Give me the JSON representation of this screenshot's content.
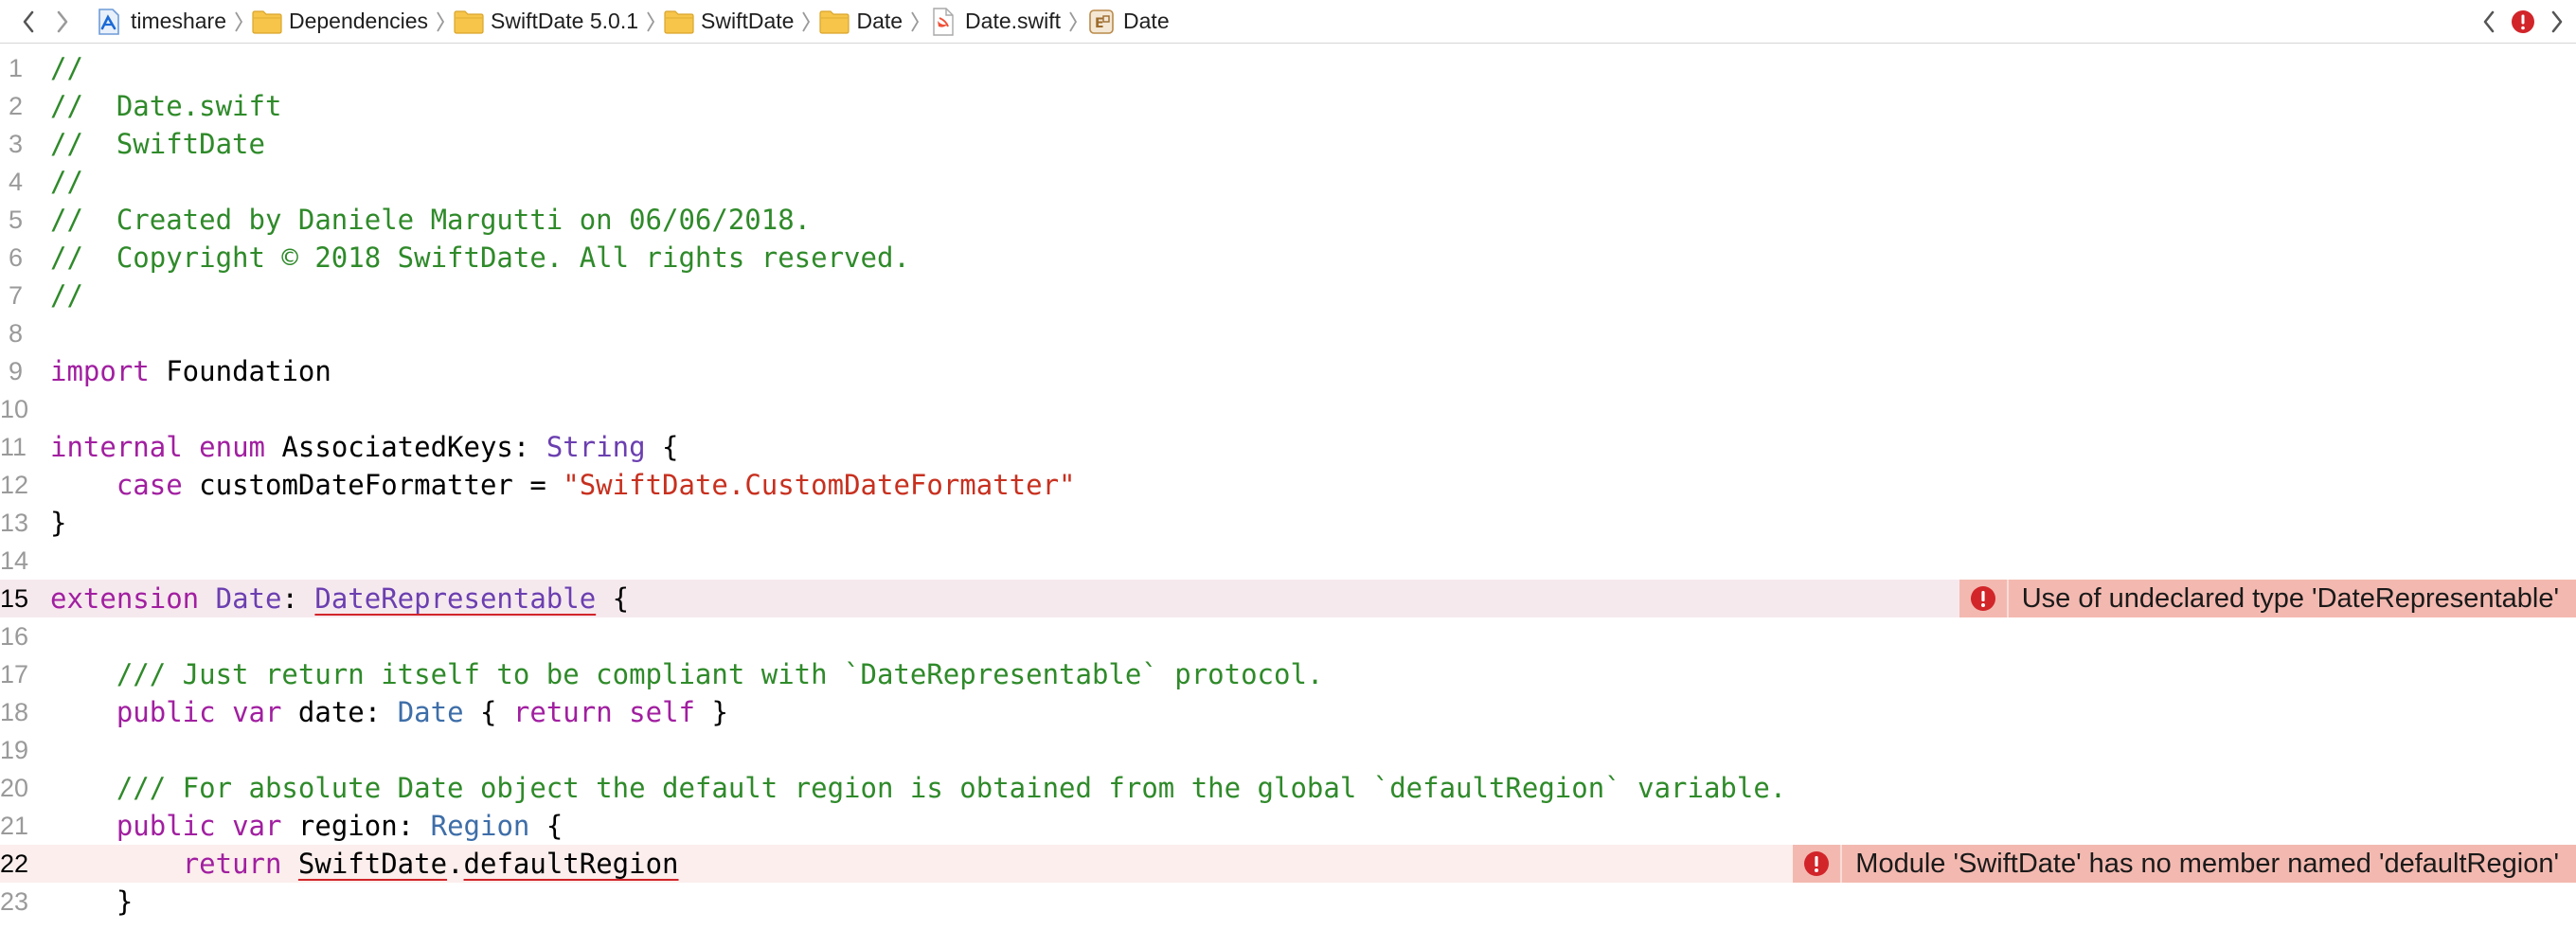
{
  "jumpbar": {
    "back_icon": "chevron-left-icon",
    "forward_icon": "chevron-right-icon",
    "crumbs": [
      {
        "label": "timeshare",
        "icon": "xcode-project-icon"
      },
      {
        "label": "Dependencies",
        "icon": "folder-icon"
      },
      {
        "label": "SwiftDate 5.0.1",
        "icon": "folder-icon"
      },
      {
        "label": "SwiftDate",
        "icon": "folder-icon"
      },
      {
        "label": "Date",
        "icon": "folder-icon"
      },
      {
        "label": "Date.swift",
        "icon": "swift-file-icon"
      },
      {
        "label": "Date",
        "icon": "extension-icon"
      }
    ],
    "issue_icon": "error-icon"
  },
  "editor": {
    "lines": [
      {
        "n": "1",
        "text": "//"
      },
      {
        "n": "2",
        "text": "//  Date.swift"
      },
      {
        "n": "3",
        "text": "//  SwiftDate"
      },
      {
        "n": "4",
        "text": "//"
      },
      {
        "n": "5",
        "text": "//  Created by Daniele Margutti on 06/06/2018."
      },
      {
        "n": "6",
        "text": "//  Copyright © 2018 SwiftDate. All rights reserved."
      },
      {
        "n": "7",
        "text": "//"
      },
      {
        "n": "8",
        "text": ""
      },
      {
        "n": "9",
        "kw": "import",
        "rest": " Foundation"
      },
      {
        "n": "10",
        "text": ""
      },
      {
        "n": "11",
        "kw1": "internal",
        "kw2": "enum",
        "name": " AssociatedKeys: ",
        "type": "String",
        "rest": " {"
      },
      {
        "n": "12",
        "indent": "    ",
        "kw": "case",
        "mid": " customDateFormatter = ",
        "str": "\"SwiftDate.CustomDateFormatter\""
      },
      {
        "n": "13",
        "text": "}"
      },
      {
        "n": "14",
        "text": ""
      },
      {
        "n": "15",
        "kw": "extension",
        "sp": " ",
        "type": "Date",
        "colon": ": ",
        "errtype": "DateRepresentable",
        "rest": " {"
      },
      {
        "n": "16",
        "text": ""
      },
      {
        "n": "17",
        "text": "    /// Just return itself to be compliant with `DateRepresentable` protocol."
      },
      {
        "n": "18",
        "indent": "    ",
        "kw1": "public",
        "kw2": "var",
        "mid": " date: ",
        "type": "Date",
        "b1": " { ",
        "kw3": "return",
        "sp": " ",
        "kw4": "self",
        "b2": " }"
      },
      {
        "n": "19",
        "text": ""
      },
      {
        "n": "20",
        "text": "    /// For absolute Date object the default region is obtained from the global `defaultRegion` variable."
      },
      {
        "n": "21",
        "indent": "    ",
        "kw1": "public",
        "kw2": "var",
        "mid": " region: ",
        "type": "Region",
        "rest": " {"
      },
      {
        "n": "22",
        "indent": "        ",
        "kw": "return",
        "sp": " ",
        "err1": "SwiftDate",
        "dot": ".",
        "err2": "defaultRegion"
      },
      {
        "n": "23",
        "text": "    }"
      }
    ],
    "errors": {
      "line15": "Use of undeclared type 'DateRepresentable'",
      "line22": "Module 'SwiftDate' has no member named 'defaultRegion'"
    }
  },
  "colors": {
    "comment": "#2f8a2a",
    "keyword": "#a11fa0",
    "string": "#c7301f",
    "type": "#6b3fb0",
    "error_bg": "#f3b9b0",
    "error_badge": "#d1252a"
  }
}
